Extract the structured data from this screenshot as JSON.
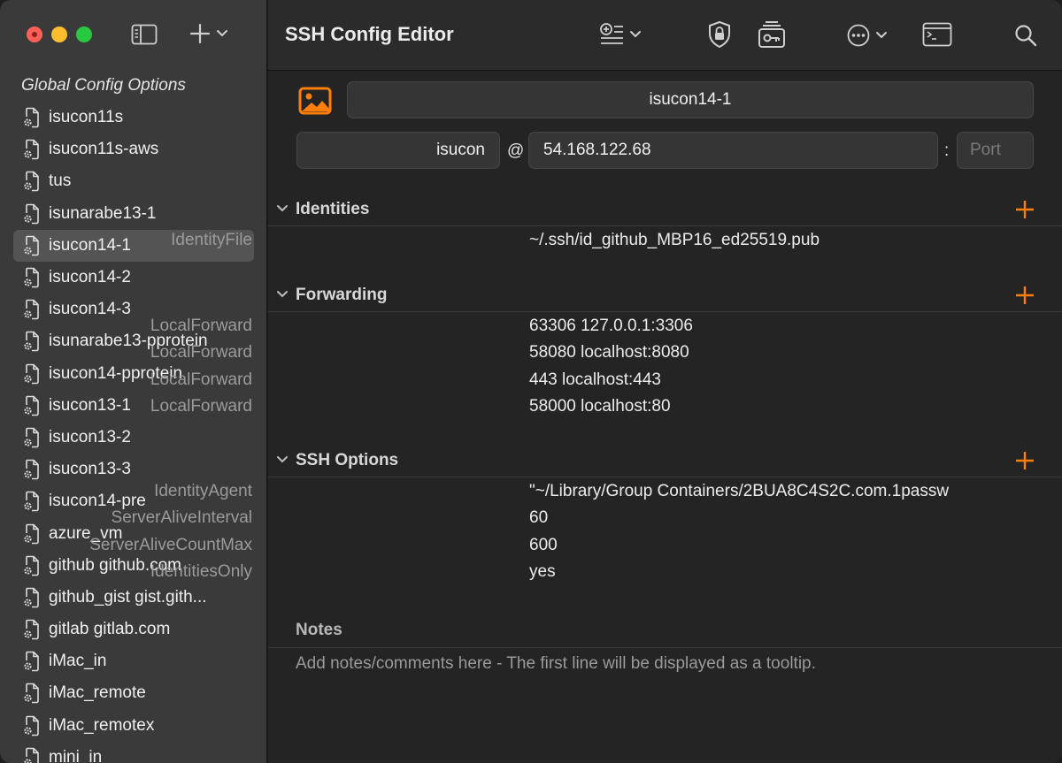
{
  "window": {
    "title": "SSH Config Editor"
  },
  "sidebar": {
    "heading": "Global Config Options",
    "hosts": [
      {
        "label": "isucon11s"
      },
      {
        "label": "isucon11s-aws"
      },
      {
        "label": "tus"
      },
      {
        "label": "isunarabe13-1"
      },
      {
        "label": "isucon14-1",
        "selected": true
      },
      {
        "label": "isucon14-2"
      },
      {
        "label": "isucon14-3"
      },
      {
        "label": "isunarabe13-pprotein"
      },
      {
        "label": "isucon14-pprotein"
      },
      {
        "label": "isucon13-1"
      },
      {
        "label": "isucon13-2"
      },
      {
        "label": "isucon13-3"
      },
      {
        "label": "isucon14-pre"
      },
      {
        "label": "azure_vm"
      },
      {
        "label": "github github.com"
      },
      {
        "label": "github_gist gist.gith..."
      },
      {
        "label": "gitlab gitlab.com"
      },
      {
        "label": "iMac_in"
      },
      {
        "label": "iMac_remote"
      },
      {
        "label": "iMac_remotex"
      },
      {
        "label": "mini_in"
      }
    ]
  },
  "host": {
    "name": "isucon14-1",
    "user": "isucon",
    "at": "@",
    "hostname": "54.168.122.68",
    "colon": ":",
    "port_placeholder": "Port"
  },
  "sections": {
    "identities": {
      "title": "Identities",
      "rows": [
        {
          "key": "IdentityFile",
          "value": "~/.ssh/id_github_MBP16_ed25519.pub"
        }
      ]
    },
    "forwarding": {
      "title": "Forwarding",
      "rows": [
        {
          "key": "LocalForward",
          "value": "63306 127.0.0.1:3306"
        },
        {
          "key": "LocalForward",
          "value": "58080 localhost:8080"
        },
        {
          "key": "LocalForward",
          "value": "443 localhost:443"
        },
        {
          "key": "LocalForward",
          "value": "58000 localhost:80"
        }
      ]
    },
    "ssh_options": {
      "title": "SSH Options",
      "rows": [
        {
          "key": "IdentityAgent",
          "value": "\"~/Library/Group Containers/2BUA8C4S2C.com.1passw"
        },
        {
          "key": "ServerAliveInterval",
          "value": "60"
        },
        {
          "key": "ServerAliveCountMax",
          "value": "600"
        },
        {
          "key": "IdentitiesOnly",
          "value": "yes"
        }
      ]
    }
  },
  "notes": {
    "title": "Notes",
    "placeholder": "Add notes/comments here - The first line will be displayed as a tooltip."
  },
  "icons": {
    "sidebar_toggle": "sidebar-icon",
    "add": "plus-icon",
    "add_entry": "add-entry-icon",
    "shield": "shield-lock-icon",
    "keychain": "keychain-icon",
    "more": "ellipsis-circle-icon",
    "terminal": "terminal-icon",
    "search": "magnifier-icon",
    "host_image": "image-icon",
    "host_file": "doc-gear-icon"
  },
  "colors": {
    "accent": "#ff7f0a",
    "sidebar_bg": "#3a3a3a",
    "selected_bg": "#545454",
    "content_bg": "#242424"
  }
}
